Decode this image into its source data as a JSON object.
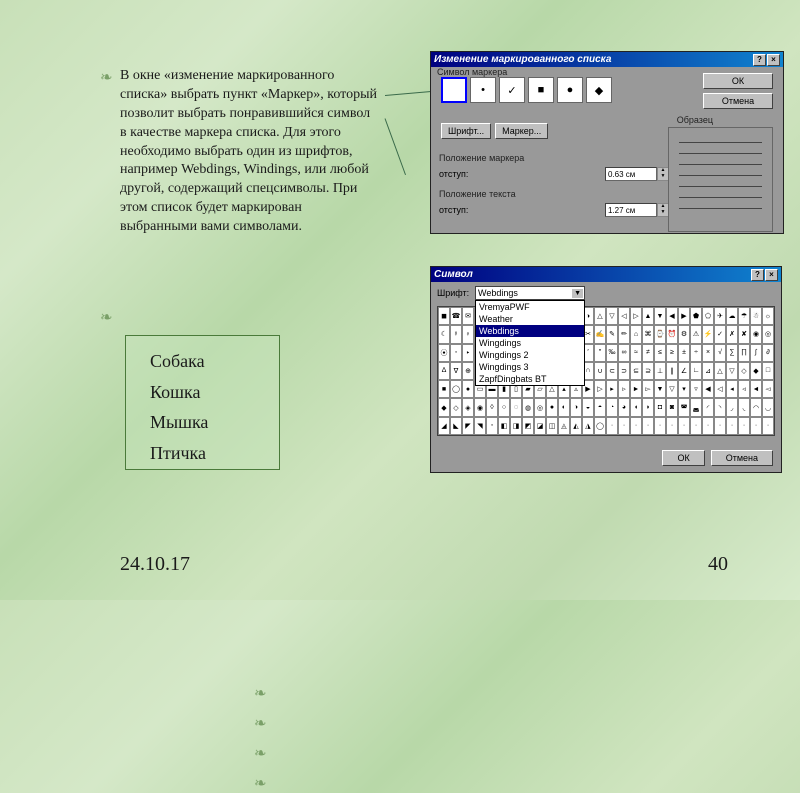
{
  "description": {
    "text": "В окне «изменение маркированного списка» выбрать пункт «Маркер», который позволит выбрать понравившийся символ в качестве маркера списка. Для этого необходимо выбрать один из шрифтов, например Webdings, Windings, или любой другой, содержащий спецсимволы. При этом список будет маркирован выбранными вами символами."
  },
  "example_list": [
    "Собака",
    "Кошка",
    "Мышка",
    "Птичка"
  ],
  "dialog1": {
    "title": "Изменение маркированного списка",
    "ok": "ОК",
    "cancel": "Отмена",
    "markers_label": "Символ маркера",
    "font_btn": "Шрифт...",
    "marker_btn": "Маркер...",
    "pos_marker_label": "Положение маркера",
    "pos_text_label": "Положение текста",
    "indent_label": "отступ:",
    "indent1": "0.63 см",
    "indent2": "1.27 см",
    "preview_label": "Образец"
  },
  "dialog2": {
    "title": "Символ",
    "font_label": "Шрифт:",
    "font_selected": "Webdings",
    "font_options": [
      "VremyaPWF",
      "Weather",
      "Webdings",
      "Wingdings",
      "Wingdings 2",
      "Wingdings 3",
      "ZapfDingbats BT"
    ],
    "ok": "ОК",
    "cancel": "Отмена"
  },
  "markers": [
    "",
    "•",
    "✓",
    "■",
    "●",
    "◆"
  ],
  "footer": {
    "date": "24.10.17",
    "page": "40"
  }
}
